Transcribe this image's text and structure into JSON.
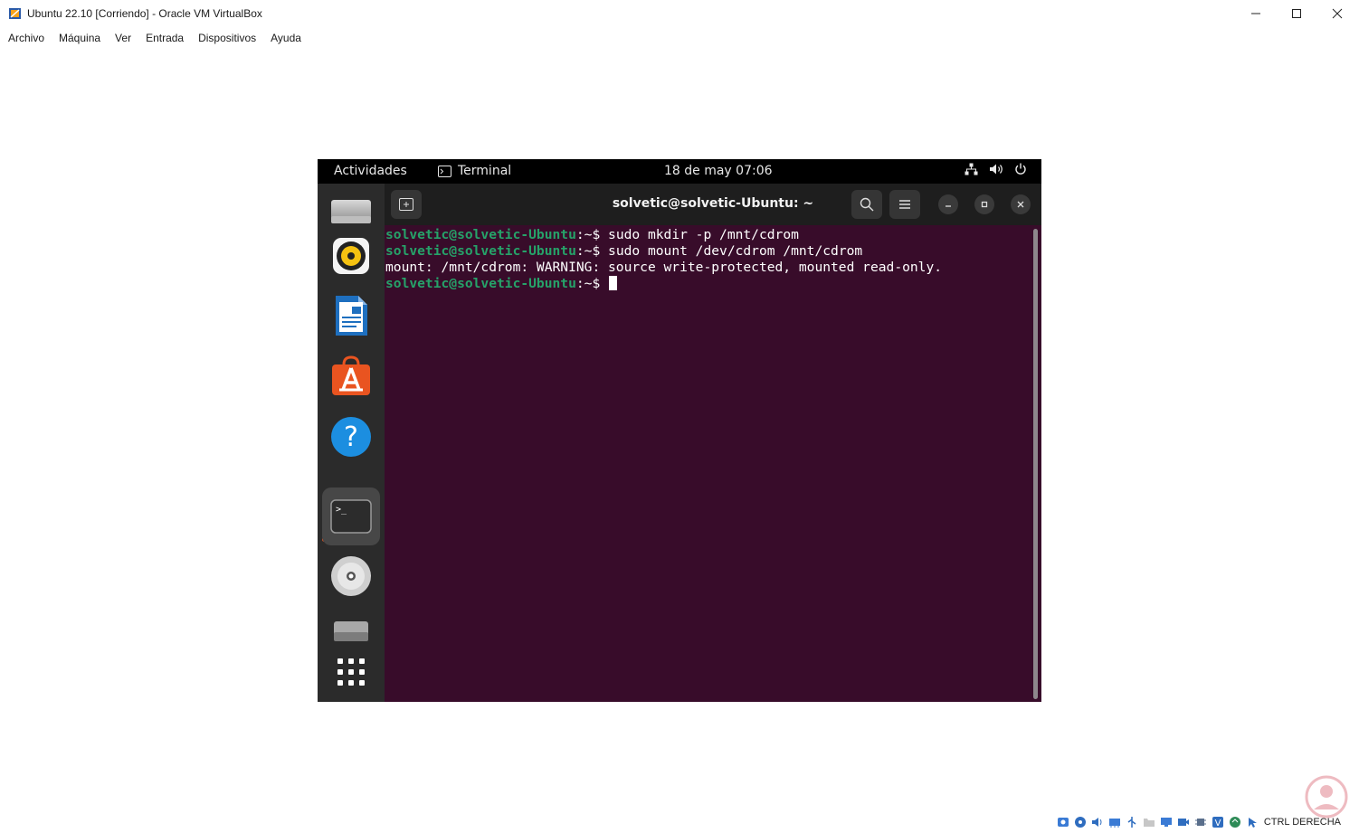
{
  "window": {
    "title": "Ubuntu 22.10 [Corriendo] - Oracle VM VirtualBox",
    "controls": {
      "minimize": "—",
      "maximize": "☐",
      "close": "✕"
    }
  },
  "menu": [
    "Archivo",
    "Máquina",
    "Ver",
    "Entrada",
    "Dispositivos",
    "Ayuda"
  ],
  "gnome_topbar": {
    "activities": "Actividades",
    "app_name": "Terminal",
    "clock": "18 de may  07:06"
  },
  "dock": {
    "items": [
      {
        "name": "files",
        "icon": "drive-icon"
      },
      {
        "name": "rhythmbox",
        "icon": "speaker-icon"
      },
      {
        "name": "libreoffice-writer",
        "icon": "document-icon"
      },
      {
        "name": "app-center",
        "icon": "store-icon"
      },
      {
        "name": "help",
        "icon": "help-icon"
      },
      {
        "name": "terminal",
        "icon": "terminal-icon",
        "active": true
      },
      {
        "name": "cdrom",
        "icon": "disc-icon"
      },
      {
        "name": "drive",
        "icon": "drive-icon"
      },
      {
        "name": "show-apps",
        "icon": "grid-icon"
      }
    ]
  },
  "terminal": {
    "title": "solvetic@solvetic-Ubuntu: ~",
    "prompt_user": "solvetic@solvetic-Ubuntu",
    "prompt_suffix": ":~$ ",
    "lines": [
      {
        "type": "cmd",
        "text": "sudo mkdir -p /mnt/cdrom"
      },
      {
        "type": "cmd",
        "text": "sudo mount /dev/cdrom /mnt/cdrom"
      },
      {
        "type": "out",
        "text": "mount: /mnt/cdrom: WARNING: source write-protected, mounted read-only."
      },
      {
        "type": "cmd",
        "text": ""
      }
    ]
  },
  "statusbar": {
    "host_key": "CTRL DERECHA"
  },
  "colors": {
    "terminal_bg": "#380c2a",
    "prompt_green": "#26a269",
    "dock_bg": "#2b2b2b",
    "ubuntu_orange": "#e95420"
  }
}
